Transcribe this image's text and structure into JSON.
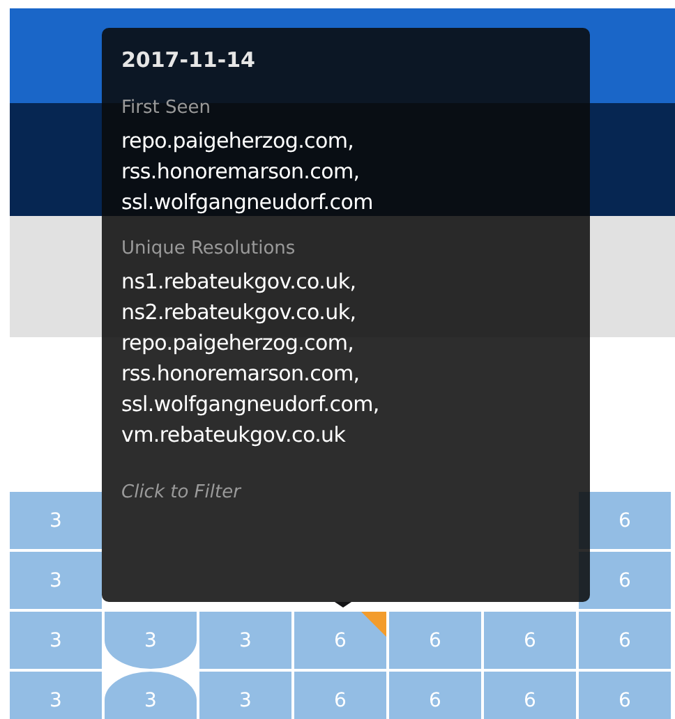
{
  "tooltip": {
    "date": "2017-11-14",
    "sections": [
      {
        "label": "First Seen",
        "items": [
          "repo.paigeherzog.com,",
          "rss.honoremarson.com,",
          "ssl.wolfgangneudorf.com"
        ]
      },
      {
        "label": "Unique Resolutions",
        "items": [
          "ns1.rebateukgov.co.uk,",
          "ns2.rebateukgov.co.uk,",
          "repo.paigeherzog.com,",
          "rss.honoremarson.com,",
          "ssl.wolfgangneudorf.com,",
          "vm.rebateukgov.co.uk"
        ]
      }
    ],
    "hint": "Click to Filter"
  },
  "grid": {
    "rows": [
      [
        {
          "value": "3",
          "kind": "square",
          "flagged": false
        },
        null,
        null,
        null,
        null,
        null,
        {
          "value": "6",
          "kind": "square",
          "flagged": false
        }
      ],
      [
        {
          "value": "3",
          "kind": "square",
          "flagged": false
        },
        null,
        null,
        null,
        null,
        null,
        {
          "value": "6",
          "kind": "square",
          "flagged": false
        }
      ],
      [
        {
          "value": "3",
          "kind": "square",
          "flagged": false
        },
        {
          "value": "3",
          "kind": "round-bottom",
          "flagged": false
        },
        {
          "value": "3",
          "kind": "square",
          "flagged": false
        },
        {
          "value": "6",
          "kind": "square",
          "flagged": true
        },
        {
          "value": "6",
          "kind": "square",
          "flagged": false
        },
        {
          "value": "6",
          "kind": "square",
          "flagged": false
        },
        {
          "value": "6",
          "kind": "square",
          "flagged": false
        }
      ],
      [
        {
          "value": "3",
          "kind": "square",
          "flagged": false
        },
        {
          "value": "3",
          "kind": "round-top",
          "flagged": false
        },
        {
          "value": "3",
          "kind": "square",
          "flagged": false
        },
        {
          "value": "6",
          "kind": "square",
          "flagged": false
        },
        {
          "value": "6",
          "kind": "square",
          "flagged": false
        },
        {
          "value": "6",
          "kind": "square",
          "flagged": false
        },
        {
          "value": "6",
          "kind": "square",
          "flagged": false
        }
      ]
    ]
  }
}
